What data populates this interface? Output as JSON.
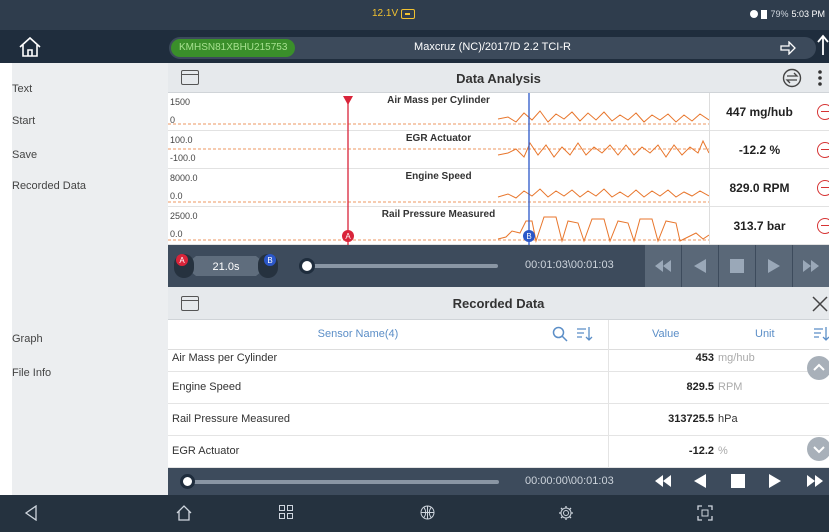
{
  "status_bar": {
    "voltage": "12.1V",
    "battery": "79%",
    "time": "5:03 PM"
  },
  "header": {
    "vin": "KMHSN81XBHU215753",
    "vehicle": "Maxcruz (NC)/2017/D 2.2 TCI-R"
  },
  "sidebar": {
    "items": [
      {
        "label": "Text"
      },
      {
        "label": "Start"
      },
      {
        "label": "Save"
      },
      {
        "label": "Recorded Data"
      },
      {
        "label": "Graph"
      },
      {
        "label": "File Info"
      }
    ]
  },
  "data_analysis": {
    "title": "Data Analysis",
    "rows": [
      {
        "name": "Air Mass per Cylinder",
        "max": "1500",
        "min": "0",
        "value": "447 mg/hub"
      },
      {
        "name": "EGR Actuator",
        "max": "100.0",
        "min": "-100.0",
        "value": "-12.2 %"
      },
      {
        "name": "Engine Speed",
        "max": "8000.0",
        "min": "0.0",
        "value": "829.0 RPM"
      },
      {
        "name": "Rail Pressure Measured",
        "max": "2500.0",
        "min": "0.0",
        "value": "313.7 bar"
      }
    ],
    "cursor_a_label": "A",
    "cursor_b_label": "B"
  },
  "playback_top": {
    "ab_a": "A",
    "ab_b": "B",
    "interval": "21.0s",
    "progress": 0.0,
    "time": "00:01:03\\00:01:03"
  },
  "recorded_data": {
    "title": "Recorded Data",
    "headers": {
      "sensor": "Sensor Name(4)",
      "value": "Value",
      "unit": "Unit"
    },
    "rows": [
      {
        "name": "Air Mass per Cylinder",
        "value": "453",
        "unit": "mg/hub"
      },
      {
        "name": "Engine Speed",
        "value": "829.5",
        "unit": "RPM"
      },
      {
        "name": "Rail Pressure Measured",
        "value": "313725.5",
        "unit": "hPa"
      },
      {
        "name": "EGR Actuator",
        "value": "-12.2",
        "unit": "%"
      }
    ]
  },
  "playback_bottom": {
    "progress": 0.0,
    "time": "00:00:00\\00:01:03"
  },
  "colors": {
    "trace": "#e8762c",
    "cursor_a": "#d9243a",
    "cursor_b": "#2b57c8",
    "header_bg": "#1f2d3d",
    "vin_bg": "#3a8f2a"
  }
}
